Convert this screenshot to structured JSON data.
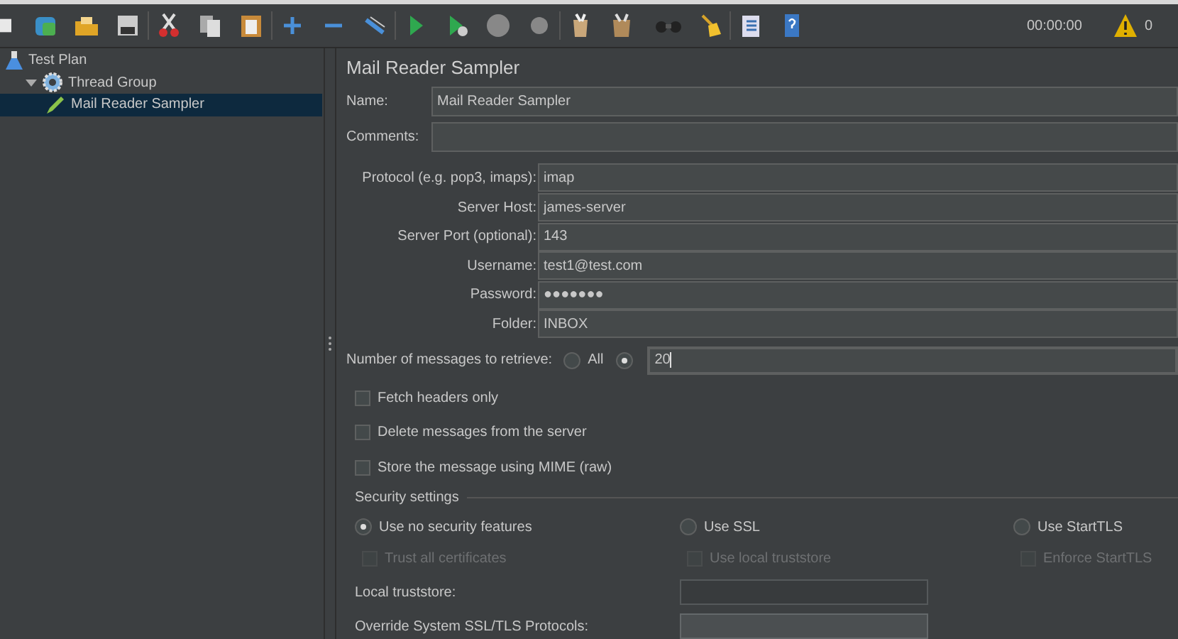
{
  "toolbar": {
    "elapsed": "00:00:00",
    "warnings": "0"
  },
  "tree": [
    {
      "label": "Test Plan",
      "kind": "plan",
      "selected": false,
      "children": [
        {
          "label": "Thread Group",
          "kind": "group",
          "selected": false,
          "expanded": true,
          "children": [
            {
              "label": "Mail Reader Sampler",
              "kind": "sampler",
              "selected": true
            }
          ]
        }
      ]
    }
  ],
  "panel": {
    "title": "Mail Reader Sampler",
    "name": {
      "label": "Name:",
      "value": "Mail Reader Sampler"
    },
    "comments": {
      "label": "Comments:"
    },
    "fields": [
      {
        "label": "Protocol (e.g. pop3, imaps):",
        "value": "imap"
      },
      {
        "label": "Server Host:",
        "value": "james-server"
      },
      {
        "label": "Server Port (optional):",
        "value": "143"
      },
      {
        "label": "Username:",
        "value": "test1@test.com"
      },
      {
        "label": "Password:",
        "value": "●●●●●●●"
      },
      {
        "label": "Folder:",
        "value": "INBOX"
      }
    ],
    "messages": {
      "label": "Number of messages to retrieve:",
      "options": [
        {
          "label": "All",
          "selected": false
        },
        {
          "selected": true,
          "value": "20",
          "focused": true
        }
      ]
    },
    "checkboxes": [
      {
        "label": "Fetch headers only",
        "checked": false
      },
      {
        "label": "Delete messages from the server",
        "checked": false
      },
      {
        "label": "Store the message using MIME (raw)",
        "checked": false
      }
    ],
    "security": {
      "title": "Security settings",
      "radios": [
        {
          "label": "Use no security features",
          "selected": true
        },
        {
          "label": "Use SSL",
          "selected": false
        },
        {
          "label": "Use StartTLS",
          "selected": false
        }
      ],
      "checkboxes": [
        {
          "label": "Trust all certificates",
          "checked": false,
          "disabled": true
        },
        {
          "label": "Use local truststore",
          "checked": false,
          "disabled": true
        },
        {
          "label": "Enforce StartTLS",
          "checked": false,
          "disabled": true
        }
      ],
      "fields": [
        {
          "label": "Local truststore:",
          "disabled": true
        },
        {
          "label": "Override System SSL/TLS Protocols:",
          "disabled": false
        }
      ]
    }
  }
}
